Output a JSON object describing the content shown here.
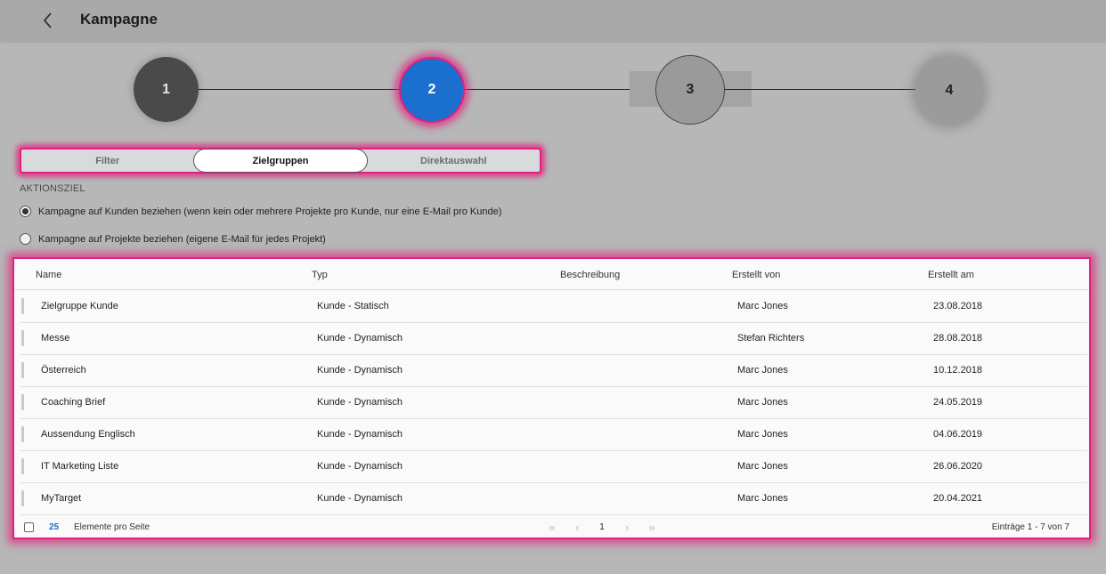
{
  "header": {
    "title": "Kampagne",
    "back_icon": "chevron-left-icon"
  },
  "stepper": {
    "steps": [
      "1",
      "2",
      "3",
      "4"
    ],
    "active": "2",
    "active_color": "#1a6fcf",
    "highlight_color": "#e2207f"
  },
  "tabs": [
    {
      "label": "Filter",
      "active": false
    },
    {
      "label": "Zielgruppen",
      "active": true
    },
    {
      "label": "Direktauswahl",
      "active": false
    }
  ],
  "aktionsziel": {
    "label": "AKTIONSZIEL",
    "options": [
      {
        "label": "Kampagne auf Kunden beziehen (wenn kein oder mehrere Projekte pro Kunde, nur eine E-Mail pro Kunde)",
        "checked": true
      },
      {
        "label": "Kampagne auf Projekte beziehen (eigene E-Mail für jedes Projekt)",
        "checked": false
      }
    ]
  },
  "table": {
    "columns": [
      "Name",
      "Typ",
      "Beschreibung",
      "Erstellt von",
      "Erstellt am"
    ],
    "rows": [
      [
        "Zielgruppe Kunde",
        "Kunde - Statisch",
        "",
        "Marc Jones",
        "23.08.2018"
      ],
      [
        "Messe",
        "Kunde - Dynamisch",
        "",
        "Stefan Richters",
        "28.08.2018"
      ],
      [
        "Österreich",
        "Kunde - Dynamisch",
        "",
        "Marc Jones",
        "10.12.2018"
      ],
      [
        "Coaching Brief",
        "Kunde - Dynamisch",
        "",
        "Marc Jones",
        "24.05.2019"
      ],
      [
        "Aussendung Englisch",
        "Kunde - Dynamisch",
        "",
        "Marc Jones",
        "04.06.2019"
      ],
      [
        "IT Marketing Liste",
        "Kunde - Dynamisch",
        "",
        "Marc Jones",
        "26.06.2020"
      ],
      [
        "MyTarget",
        "Kunde - Dynamisch",
        "",
        "Marc Jones",
        "20.04.2021"
      ]
    ]
  },
  "footer": {
    "page_size": "25",
    "per_page_label": "Elemente pro Seite",
    "pager": {
      "first": "«",
      "prev": "‹",
      "current": "1",
      "next": "›",
      "last": "»"
    },
    "entries_label": "Einträge 1 - 7 von 7"
  }
}
